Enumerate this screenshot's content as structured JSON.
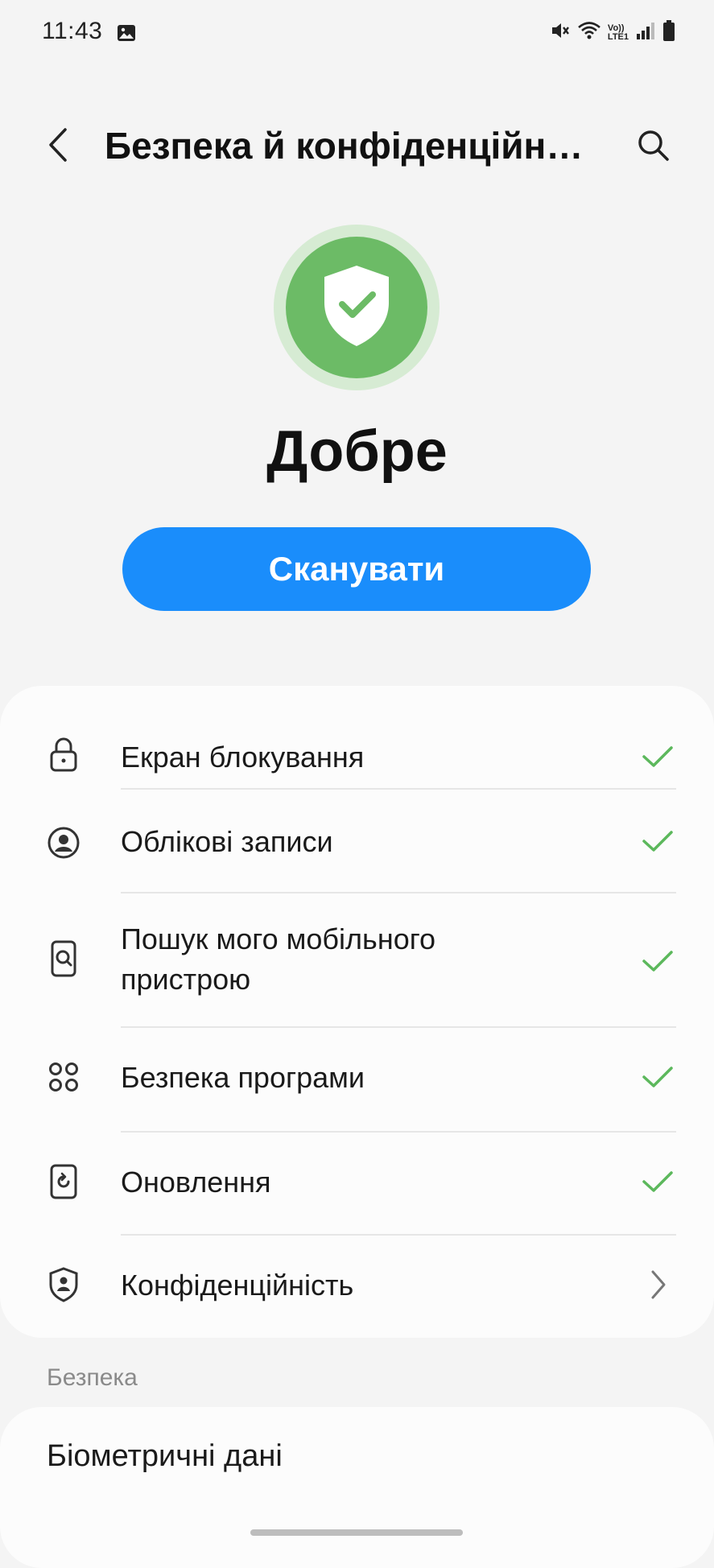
{
  "status_bar": {
    "time": "11:43",
    "icons": [
      "image-icon",
      "mute-icon",
      "wifi-icon",
      "volte-icon",
      "signal-icon",
      "battery-icon"
    ],
    "volte_text_top": "Vo))",
    "volte_text_bottom": "LTE1"
  },
  "header": {
    "title": "Безпека й конфіденційн…",
    "back_icon": "chevron-left-icon",
    "search_icon": "search-icon"
  },
  "summary": {
    "status": "Добре",
    "status_color": "#6cbb66",
    "scan_button": "Сканувати",
    "accent": "#1a8dfb"
  },
  "items": [
    {
      "label": "Екран блокування",
      "icon": "lock-icon",
      "state": "check"
    },
    {
      "label": "Облікові записи",
      "icon": "account-icon",
      "state": "check"
    },
    {
      "label_line1": "Пошук мого мобільного",
      "label_line2": "пристрою",
      "icon": "find-device-icon",
      "state": "check"
    },
    {
      "label": "Безпека програми",
      "icon": "apps-icon",
      "state": "check"
    },
    {
      "label": "Оновлення",
      "icon": "update-icon",
      "state": "check"
    },
    {
      "label": "Конфіденційність",
      "icon": "privacy-shield-icon",
      "state": "chevron"
    }
  ],
  "section": {
    "title": "Безпека",
    "first_item": "Біометричні дані"
  }
}
